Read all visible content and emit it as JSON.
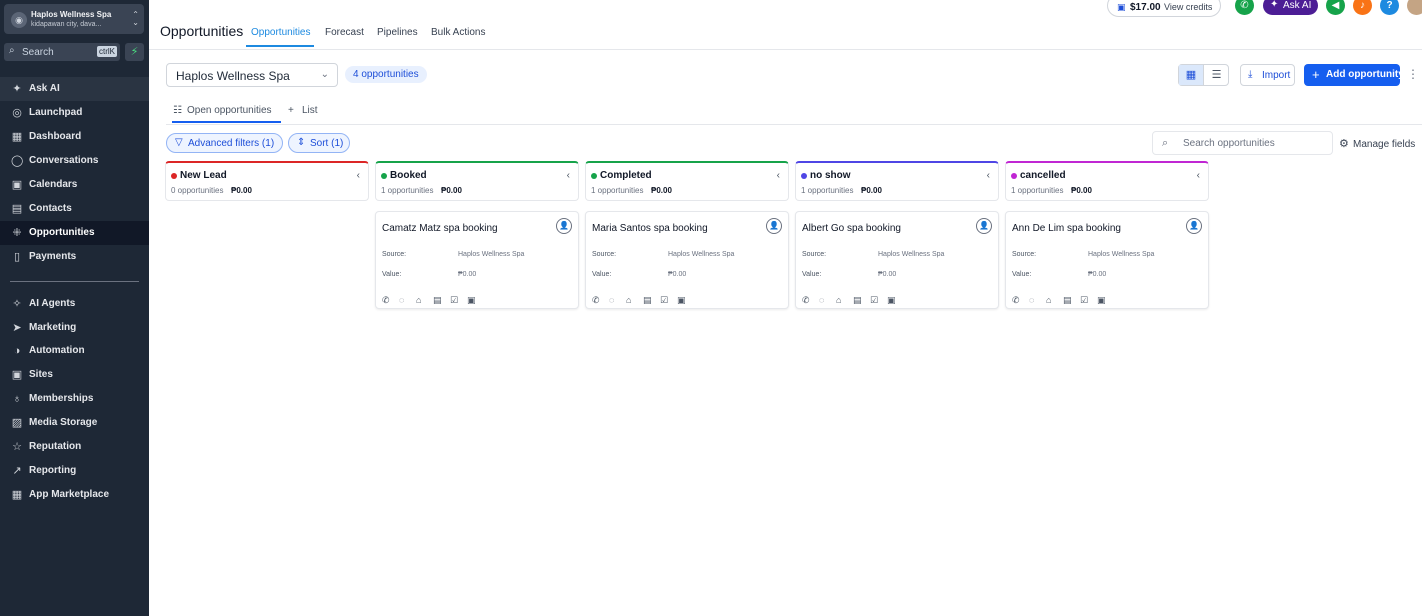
{
  "account": {
    "name": "Haplos Wellness Spa",
    "location": "kidapawan city, dava..."
  },
  "sidebar": {
    "search_placeholder": "Search",
    "search_shortcut": "ctrlK",
    "items": [
      {
        "label": "Ask AI",
        "icon": "sparkle-icon"
      },
      {
        "label": "Launchpad",
        "icon": "rocket-icon"
      },
      {
        "label": "Dashboard",
        "icon": "grid-icon"
      },
      {
        "label": "Conversations",
        "icon": "chat-icon"
      },
      {
        "label": "Calendars",
        "icon": "calendar-icon"
      },
      {
        "label": "Contacts",
        "icon": "contacts-icon"
      },
      {
        "label": "Opportunities",
        "icon": "opportunities-icon"
      },
      {
        "label": "Payments",
        "icon": "payments-icon"
      },
      {
        "label": "AI Agents",
        "icon": "ai-agents-icon"
      },
      {
        "label": "Marketing",
        "icon": "send-icon"
      },
      {
        "label": "Automation",
        "icon": "automation-icon"
      },
      {
        "label": "Sites",
        "icon": "sites-icon"
      },
      {
        "label": "Memberships",
        "icon": "award-icon"
      },
      {
        "label": "Media Storage",
        "icon": "image-icon"
      },
      {
        "label": "Reputation",
        "icon": "star-icon"
      },
      {
        "label": "Reporting",
        "icon": "trend-icon"
      },
      {
        "label": "App Marketplace",
        "icon": "apps-icon"
      }
    ]
  },
  "header": {
    "title": "Opportunities",
    "tabs": [
      "Opportunities",
      "Forecast",
      "Pipelines",
      "Bulk Actions"
    ],
    "credits_amount": "$17.00",
    "credits_label": "View credits",
    "ask_ai": "Ask AI",
    "help": "?"
  },
  "toolbar": {
    "pipeline": "Haplos Wellness Spa",
    "count": "4 opportunities",
    "import": "Import",
    "add": "Add opportunity",
    "subtabs": [
      "Open opportunities",
      "List"
    ],
    "filters": [
      "Advanced filters (1)",
      "Sort (1)"
    ],
    "search_placeholder": "Search opportunities",
    "manage_fields": "Manage fields"
  },
  "colors": {
    "accent": "#155eef",
    "sidebar_bg": "#1e2836",
    "new_lead": "#dc2626",
    "booked": "#16a34a",
    "completed": "#16a34a",
    "no_show": "#4f46e5",
    "cancelled": "#c026d3"
  },
  "columns": [
    {
      "name": "New Lead",
      "count": "0 opportunities",
      "amount": "₱0.00",
      "color": "#dc2626"
    },
    {
      "name": "Booked",
      "count": "1 opportunities",
      "amount": "₱0.00",
      "color": "#16a34a"
    },
    {
      "name": "Completed",
      "count": "1 opportunities",
      "amount": "₱0.00",
      "color": "#16a34a"
    },
    {
      "name": "no show",
      "count": "1 opportunities",
      "amount": "₱0.00",
      "color": "#4f46e5"
    },
    {
      "name": "cancelled",
      "count": "1 opportunities",
      "amount": "₱0.00",
      "color": "#c026d3"
    }
  ],
  "cards": [
    {
      "title": "Camatz Matz spa booking",
      "source_label": "Source:",
      "source": "Haplos Wellness Spa",
      "value_label": "Value:",
      "value": "₱0.00"
    },
    {
      "title": "Maria Santos spa booking",
      "source_label": "Source:",
      "source": "Haplos Wellness Spa",
      "value_label": "Value:",
      "value": "₱0.00"
    },
    {
      "title": "Albert Go spa booking",
      "source_label": "Source:",
      "source": "Haplos Wellness Spa",
      "value_label": "Value:",
      "value": "₱0.00"
    },
    {
      "title": "Ann De Lim spa booking",
      "source_label": "Source:",
      "source": "Haplos Wellness Spa",
      "value_label": "Value:",
      "value": "₱0.00"
    }
  ],
  "card_actions": [
    "phone-icon",
    "message-icon",
    "tag-icon",
    "note-icon",
    "task-icon",
    "appointment-icon"
  ]
}
